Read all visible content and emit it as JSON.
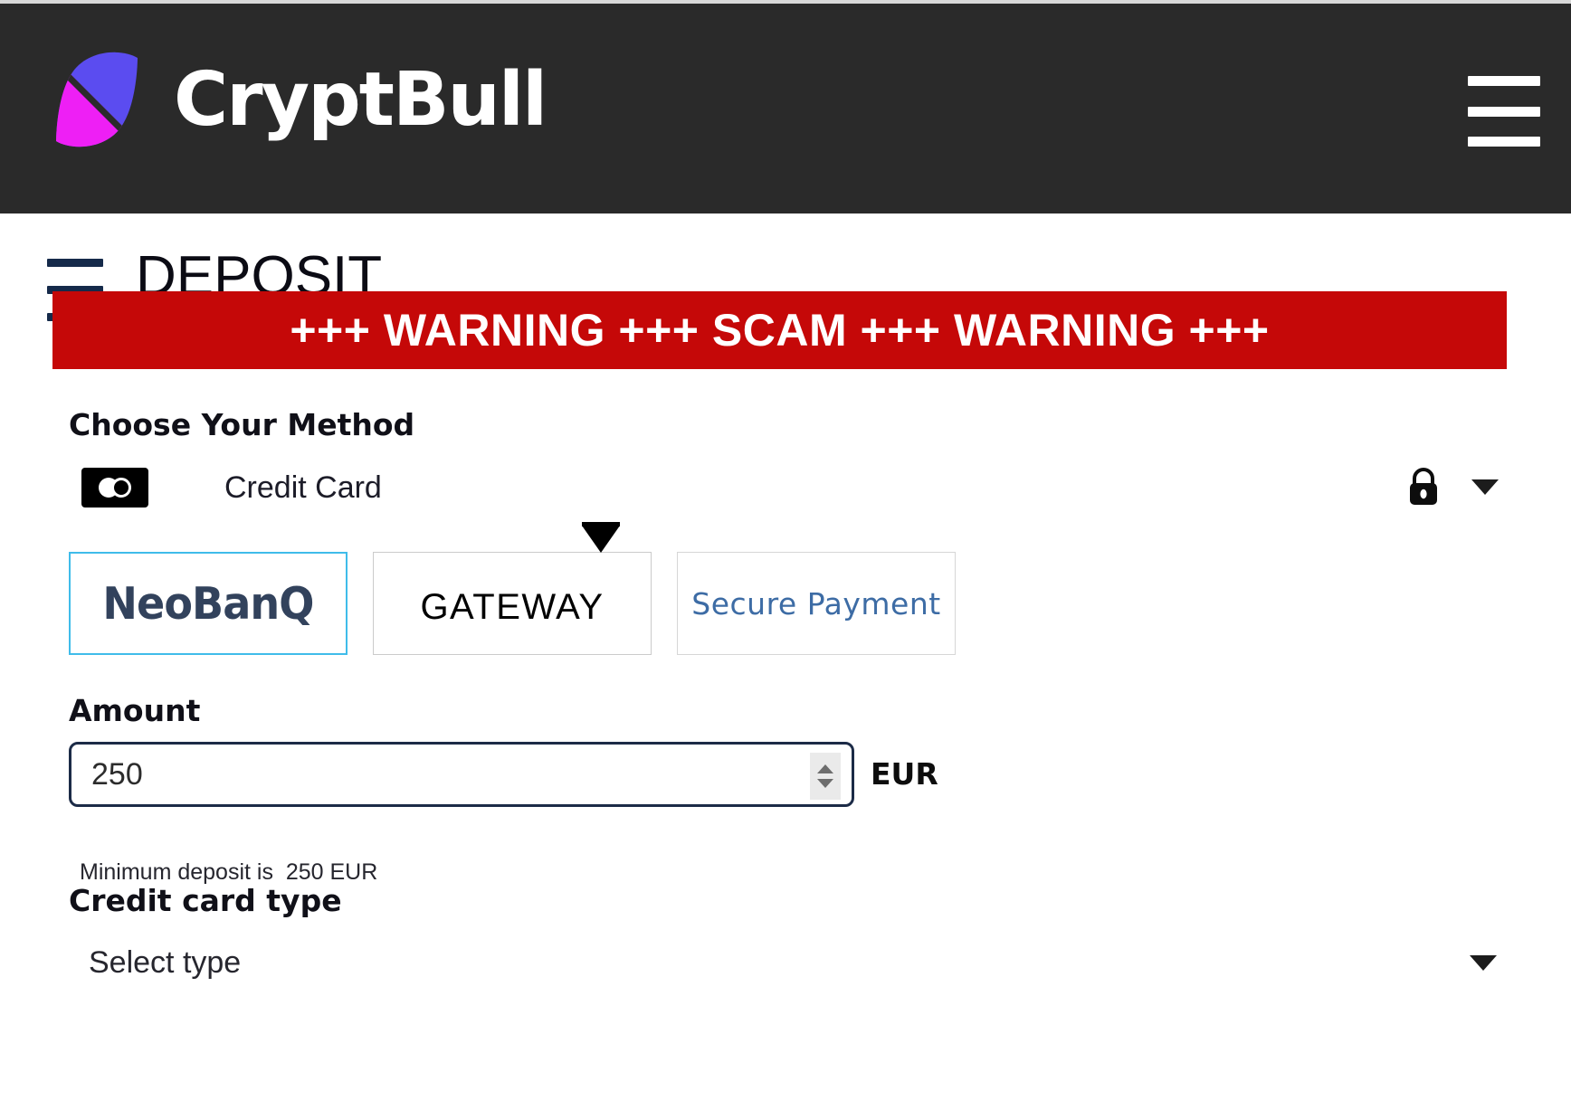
{
  "brand": {
    "name": "CryptBull",
    "logo_colors": {
      "magenta": "#ee1ff5",
      "violet": "#5b4cf0"
    }
  },
  "nav": {
    "menu_label": "menu"
  },
  "page": {
    "title": "DEPOSIT"
  },
  "warning": {
    "text": "+++ WARNING +++ SCAM +++ WARNING +++",
    "background": "#c50808",
    "color": "#ffffff"
  },
  "method": {
    "label": "Choose Your Method",
    "selected": "Credit Card",
    "lock_icon": "lock-icon",
    "caret_icon": "chevron-down-icon"
  },
  "providers": [
    {
      "name": "NeoBanQ",
      "selected": true,
      "accent": "#3fbcea",
      "text_color": "#32425c"
    },
    {
      "name": "GATEWAY",
      "selected": false,
      "text_color": "#000000"
    },
    {
      "name": "Secure Payment",
      "selected": false,
      "text_color": "#3d6ca5"
    }
  ],
  "amount": {
    "label": "Amount",
    "value": "250",
    "placeholder": "250",
    "currency": "EUR",
    "hint": "Minimum deposit is  250 EUR",
    "stepper_up": "chevron-up-icon",
    "stepper_down": "chevron-down-icon"
  },
  "card_type": {
    "label": "Credit card type",
    "selected": "Select type",
    "caret_icon": "chevron-down-icon"
  }
}
